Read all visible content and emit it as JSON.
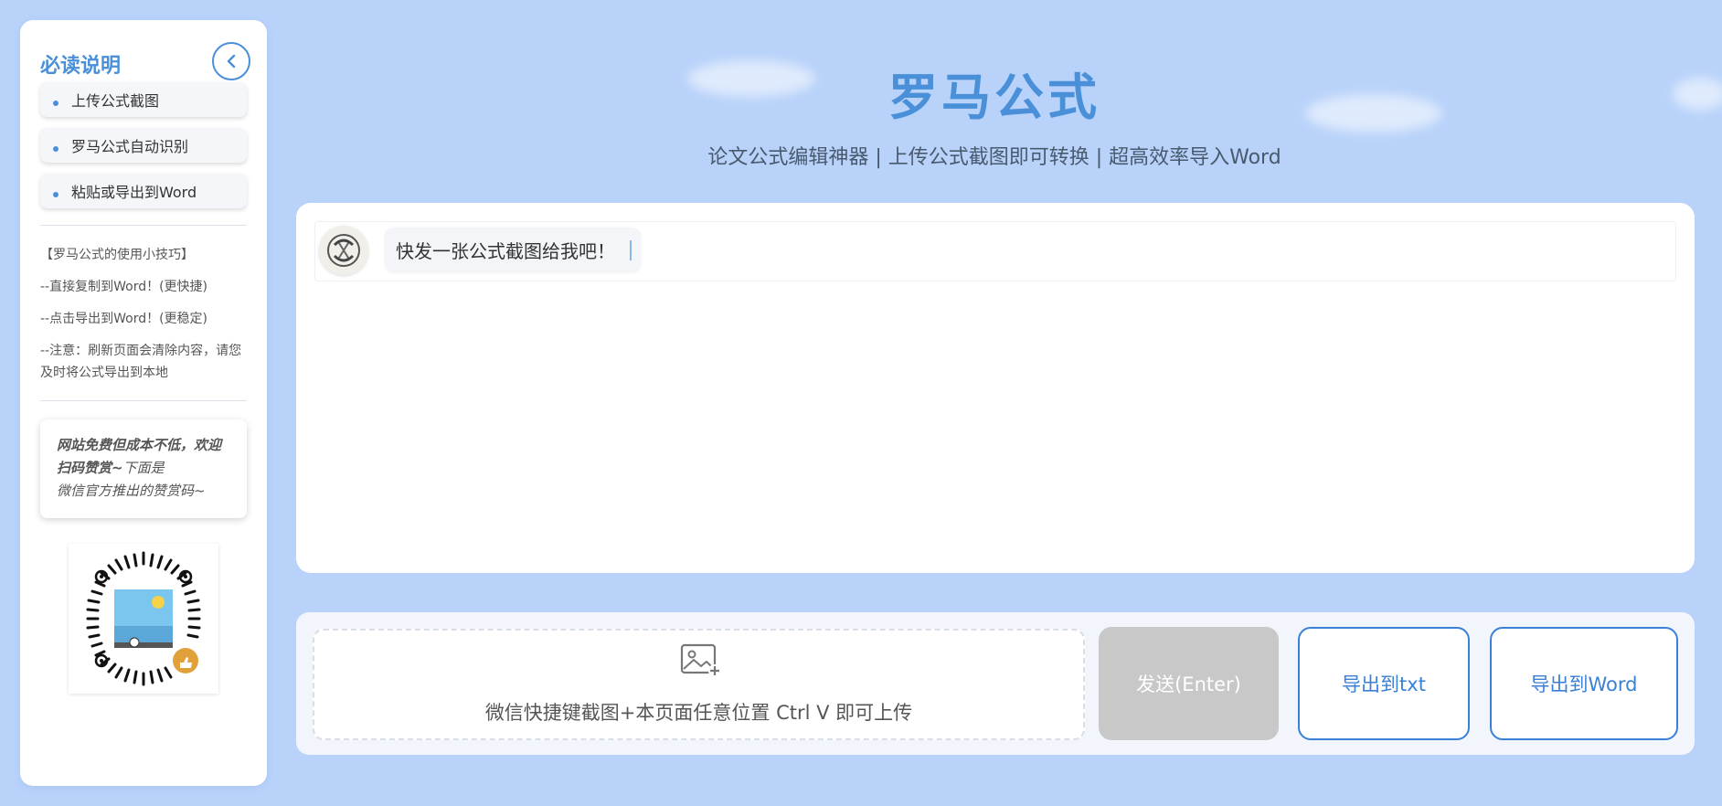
{
  "sidebar": {
    "title": "必读说明",
    "steps": [
      {
        "label": "上传公式截图"
      },
      {
        "label": "罗马公式自动识别"
      },
      {
        "label": "粘贴或导出到Word"
      }
    ],
    "tips": {
      "heading": "【罗马公式的使用小技巧】",
      "line1": "--直接复制到Word！(更快捷)",
      "line2": "--点击导出到Word！(更稳定)",
      "line3": "--注意：刷新页面会清除内容，请您及时将公式导出到本地"
    },
    "donate": {
      "bold_text": "网站免费但成本不低，欢迎扫码赞赏~",
      "line2": "下面是",
      "line3": "微信官方推出的赞赏码~"
    }
  },
  "header": {
    "title": "罗马公式",
    "subtitle": "论文公式编辑神器 | 上传公式截图即可转换 | 超高效率导入Word"
  },
  "chat": {
    "message": "快发一张公式截图给我吧！"
  },
  "bottom": {
    "upload_hint": "微信快捷键截图+本页面任意位置 Ctrl V 即可上传",
    "send_label": "发送(Enter)",
    "export_txt_label": "导出到txt",
    "export_word_label": "导出到Word"
  },
  "colors": {
    "background": "#b8d2fa",
    "accent": "#4a90d9",
    "button_border": "#3a80d6",
    "send_disabled": "#c8c8c8"
  },
  "icons": {
    "collapse": "chevron-left-icon",
    "upload": "image-add-icon"
  }
}
